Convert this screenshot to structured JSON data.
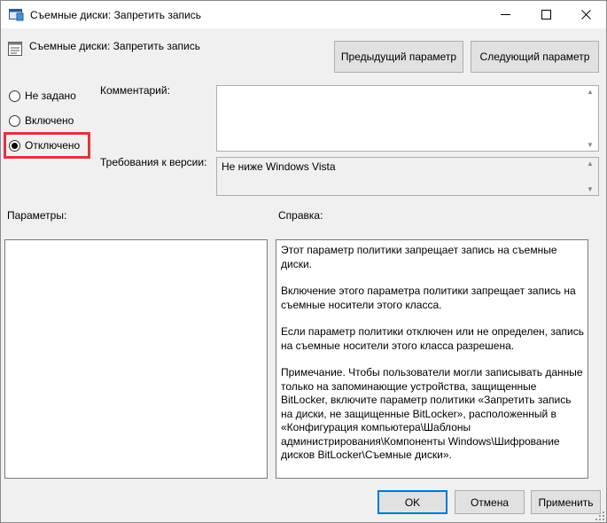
{
  "window": {
    "title": "Съемные диски: Запретить запись",
    "header": "Съемные диски: Запретить запись",
    "minimize_glyph": "—",
    "maximize_glyph": "☐",
    "close_glyph": "✕"
  },
  "nav": {
    "prev_label": "Предыдущий параметр",
    "next_label": "Следующий параметр"
  },
  "state": {
    "options": [
      {
        "label": "Не задано",
        "selected": false
      },
      {
        "label": "Включено",
        "selected": false
      },
      {
        "label": "Отключено",
        "selected": true
      }
    ],
    "highlight_color": "#e0353a"
  },
  "fields": {
    "comment_label": "Комментарий:",
    "comment_value": "",
    "requirements_label": "Требования к версии:",
    "requirements_value": "Не ниже Windows Vista"
  },
  "sections": {
    "params_label": "Параметры:",
    "help_label": "Справка:"
  },
  "help": {
    "p1": "Этот параметр политики запрещает запись на съемные диски.",
    "p2": "Включение этого параметра политики запрещает запись на съемные носители этого класса.",
    "p3": "Если параметр политики отключен или не определен, запись на съемные носители этого класса разрешена.",
    "p4": "Примечание. Чтобы пользователи могли записывать данные только на запоминающие устройства, защищенные BitLocker, включите параметр политики «Запретить запись на диски, не защищенные BitLocker», расположенный в «Конфигурация компьютера\\Шаблоны администрирования\\Компоненты Windows\\Шифрование дисков BitLocker\\Съемные диски»."
  },
  "footer": {
    "ok_label": "OK",
    "cancel_label": "Отмена",
    "apply_label": "Применить"
  },
  "colors": {
    "accent": "#0078d7",
    "window_bg": "#f0f0f0"
  }
}
